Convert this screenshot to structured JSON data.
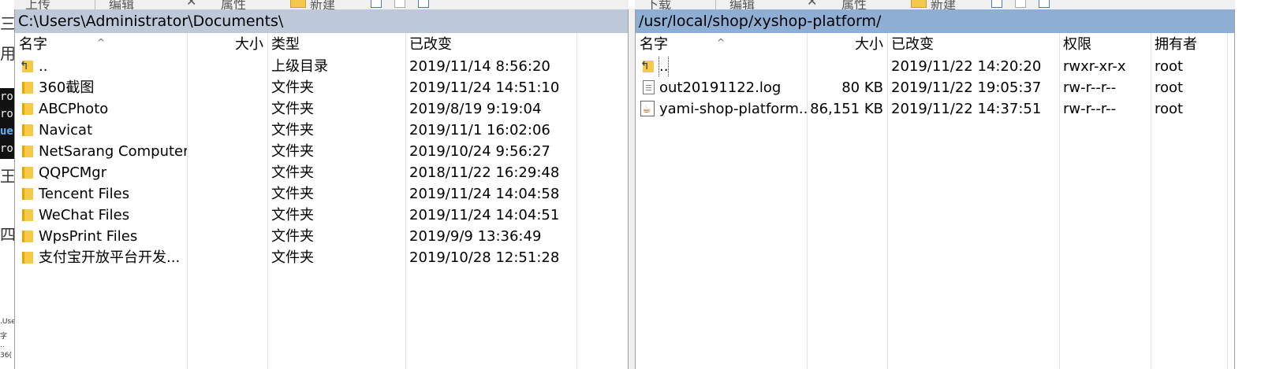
{
  "toolbar_left": {
    "upload_label": "上传",
    "rename_label": "编辑",
    "props_label": "属性",
    "new_label": "新建"
  },
  "toolbar_right": {
    "download_label": "下载",
    "rename_label": "编辑",
    "props_label": "属性",
    "new_label": "新建"
  },
  "background_app": {
    "chars": [
      "三",
      "用",
      "王",
      "四"
    ],
    "terminal_lines": [
      "ro",
      "ro",
      "ue",
      "ro"
    ],
    "tiny": [
      ".Use",
      "字",
      "..",
      "36("
    ]
  },
  "left_pane": {
    "path": "C:\\Users\\Administrator\\Documents\\",
    "columns": {
      "name": "名字",
      "size": "大小",
      "type": "类型",
      "modified": "已改变"
    },
    "rows": [
      {
        "icon": "up-folder-icon",
        "name": "..",
        "type": "上级目录",
        "modified": "2019/11/14  8:56:20"
      },
      {
        "icon": "folder-icon",
        "name": "360截图",
        "type": "文件夹",
        "modified": "2019/11/24  14:51:10"
      },
      {
        "icon": "folder-icon",
        "name": "ABCPhoto",
        "type": "文件夹",
        "modified": "2019/8/19  9:19:04"
      },
      {
        "icon": "folder-icon",
        "name": "Navicat",
        "type": "文件夹",
        "modified": "2019/11/1  16:02:06"
      },
      {
        "icon": "folder-icon",
        "name": "NetSarang Computer",
        "type": "文件夹",
        "modified": "2019/10/24  9:56:27"
      },
      {
        "icon": "folder-icon",
        "name": "QQPCMgr",
        "type": "文件夹",
        "modified": "2018/11/22  16:29:48"
      },
      {
        "icon": "folder-icon",
        "name": "Tencent Files",
        "type": "文件夹",
        "modified": "2019/11/24  14:04:58"
      },
      {
        "icon": "folder-icon",
        "name": "WeChat Files",
        "type": "文件夹",
        "modified": "2019/11/24  14:04:51"
      },
      {
        "icon": "folder-icon",
        "name": "WpsPrint Files",
        "type": "文件夹",
        "modified": "2019/9/9  13:36:49"
      },
      {
        "icon": "folder-icon",
        "name": "支付宝开放平台开发...",
        "type": "文件夹",
        "modified": "2019/10/28  12:51:28"
      }
    ]
  },
  "right_pane": {
    "path": "/usr/local/shop/xyshop-platform/",
    "columns": {
      "name": "名字",
      "size": "大小",
      "modified": "已改变",
      "perms": "权限",
      "owner": "拥有者"
    },
    "rows": [
      {
        "icon": "up-folder-icon",
        "name": "..",
        "size": "",
        "modified": "2019/11/22 14:20:20",
        "perms": "rwxr-xr-x",
        "owner": "root"
      },
      {
        "icon": "text-file-icon",
        "name": "out20191122.log",
        "size": "80 KB",
        "modified": "2019/11/22 19:05:37",
        "perms": "rw-r--r--",
        "owner": "root"
      },
      {
        "icon": "jar-file-icon",
        "name": "yami-shop-platform...",
        "size": "86,151 KB",
        "modified": "2019/11/22 14:37:51",
        "perms": "rw-r--r--",
        "owner": "root"
      }
    ]
  }
}
